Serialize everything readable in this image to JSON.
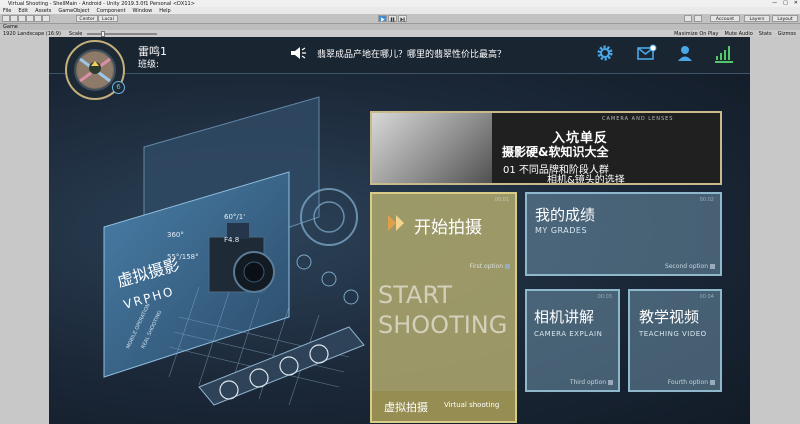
{
  "window": {
    "title": "Virtual Shooting - ShellMain - Android - Unity 2019.3.0f1 Personal <DX11>",
    "controls": [
      "—",
      "□",
      "✕"
    ]
  },
  "menu": [
    "File",
    "Edit",
    "Assets",
    "GameObject",
    "Component",
    "Window",
    "Help"
  ],
  "toolbar": {
    "center_label": "Center",
    "local_label": "Local",
    "play_icon": "play-icon",
    "pause_icon": "pause-icon",
    "step_icon": "step-icon",
    "account_label": "Account",
    "layers_label": "Layers",
    "layout_label": "Layout"
  },
  "editor_tab": {
    "label": "Game"
  },
  "game_view": {
    "resolution": "1920 Landscape (16:9)",
    "scale_label": "Scale",
    "options": [
      "Maximize On Play",
      "Mute Audio",
      "Stats",
      "Gizmos"
    ]
  },
  "user": {
    "name": "雷鸣1",
    "class_label": "班级:",
    "badge": "6"
  },
  "notice": "翡翠成品产地在哪儿？哪里的翡翠性价比最高？",
  "topbar_icons": [
    "settings-icon",
    "mail-icon",
    "user-icon",
    "signal-icon"
  ],
  "stage": {
    "title_zh": "虚拟摄影",
    "title_en": "VRPHO",
    "modes": [
      "MOBILE OPERATION",
      "REAL SHOOTING"
    ],
    "hud": [
      "360°",
      "60°/1'",
      "55°/158°",
      "F4.8"
    ]
  },
  "banner": {
    "small_text": "CAMERA AND LENSES",
    "line1": "入坑单反",
    "line2": "摄影硬&软知识大全",
    "line3": "01 不同品牌和阶段人群",
    "line4": "相机&镜头的选择"
  },
  "cards": {
    "start": {
      "title": "开始拍摄",
      "ghost": "00:01",
      "option": "First option",
      "big": "START SHOOTING",
      "footer_zh": "虚拟拍摄",
      "footer_en": "Virtual shooting"
    },
    "grades": {
      "title": "我的成绩",
      "subtitle": "MY GRADES",
      "ghost": "00:02",
      "option": "Second option"
    },
    "camera": {
      "title": "相机讲解",
      "subtitle": "CAMERA  EXPLAIN",
      "ghost": "00:03",
      "option": "Third option"
    },
    "teaching": {
      "title": "教学视频",
      "subtitle": "TEACHING  VIDEO",
      "ghost": "00:04",
      "option": "Fourth option"
    }
  }
}
